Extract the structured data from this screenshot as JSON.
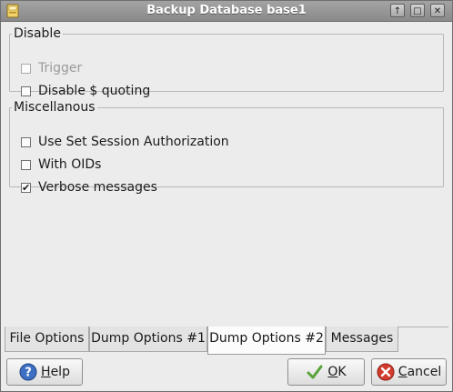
{
  "window": {
    "title": "Backup Database base1"
  },
  "titlebar_buttons": [
    {
      "name": "pin",
      "glyph": "↑"
    },
    {
      "name": "maximize",
      "glyph": "□"
    },
    {
      "name": "close",
      "glyph": "✕"
    }
  ],
  "disable_group": {
    "legend": "Disable",
    "options": [
      {
        "label": "Trigger",
        "checked": false,
        "enabled": false
      },
      {
        "label": "Disable $ quoting",
        "checked": false,
        "enabled": true
      }
    ]
  },
  "misc_group": {
    "legend": "Miscellanous",
    "options": [
      {
        "label": "Use Set Session Authorization",
        "checked": false,
        "enabled": true
      },
      {
        "label": "With OIDs",
        "checked": false,
        "enabled": true
      },
      {
        "label": "Verbose messages",
        "checked": true,
        "enabled": true
      }
    ]
  },
  "tabs": [
    {
      "label": "File Options",
      "active": false
    },
    {
      "label": "Dump Options #1",
      "active": false
    },
    {
      "label": "Dump Options #2",
      "active": true
    },
    {
      "label": "Messages",
      "active": false
    }
  ],
  "buttons": {
    "help": {
      "mnemonic": "H",
      "rest": "elp"
    },
    "ok": {
      "mnemonic": "O",
      "rest": "K"
    },
    "cancel": {
      "mnemonic": "C",
      "rest": "ancel"
    }
  },
  "checkmark": "✔"
}
